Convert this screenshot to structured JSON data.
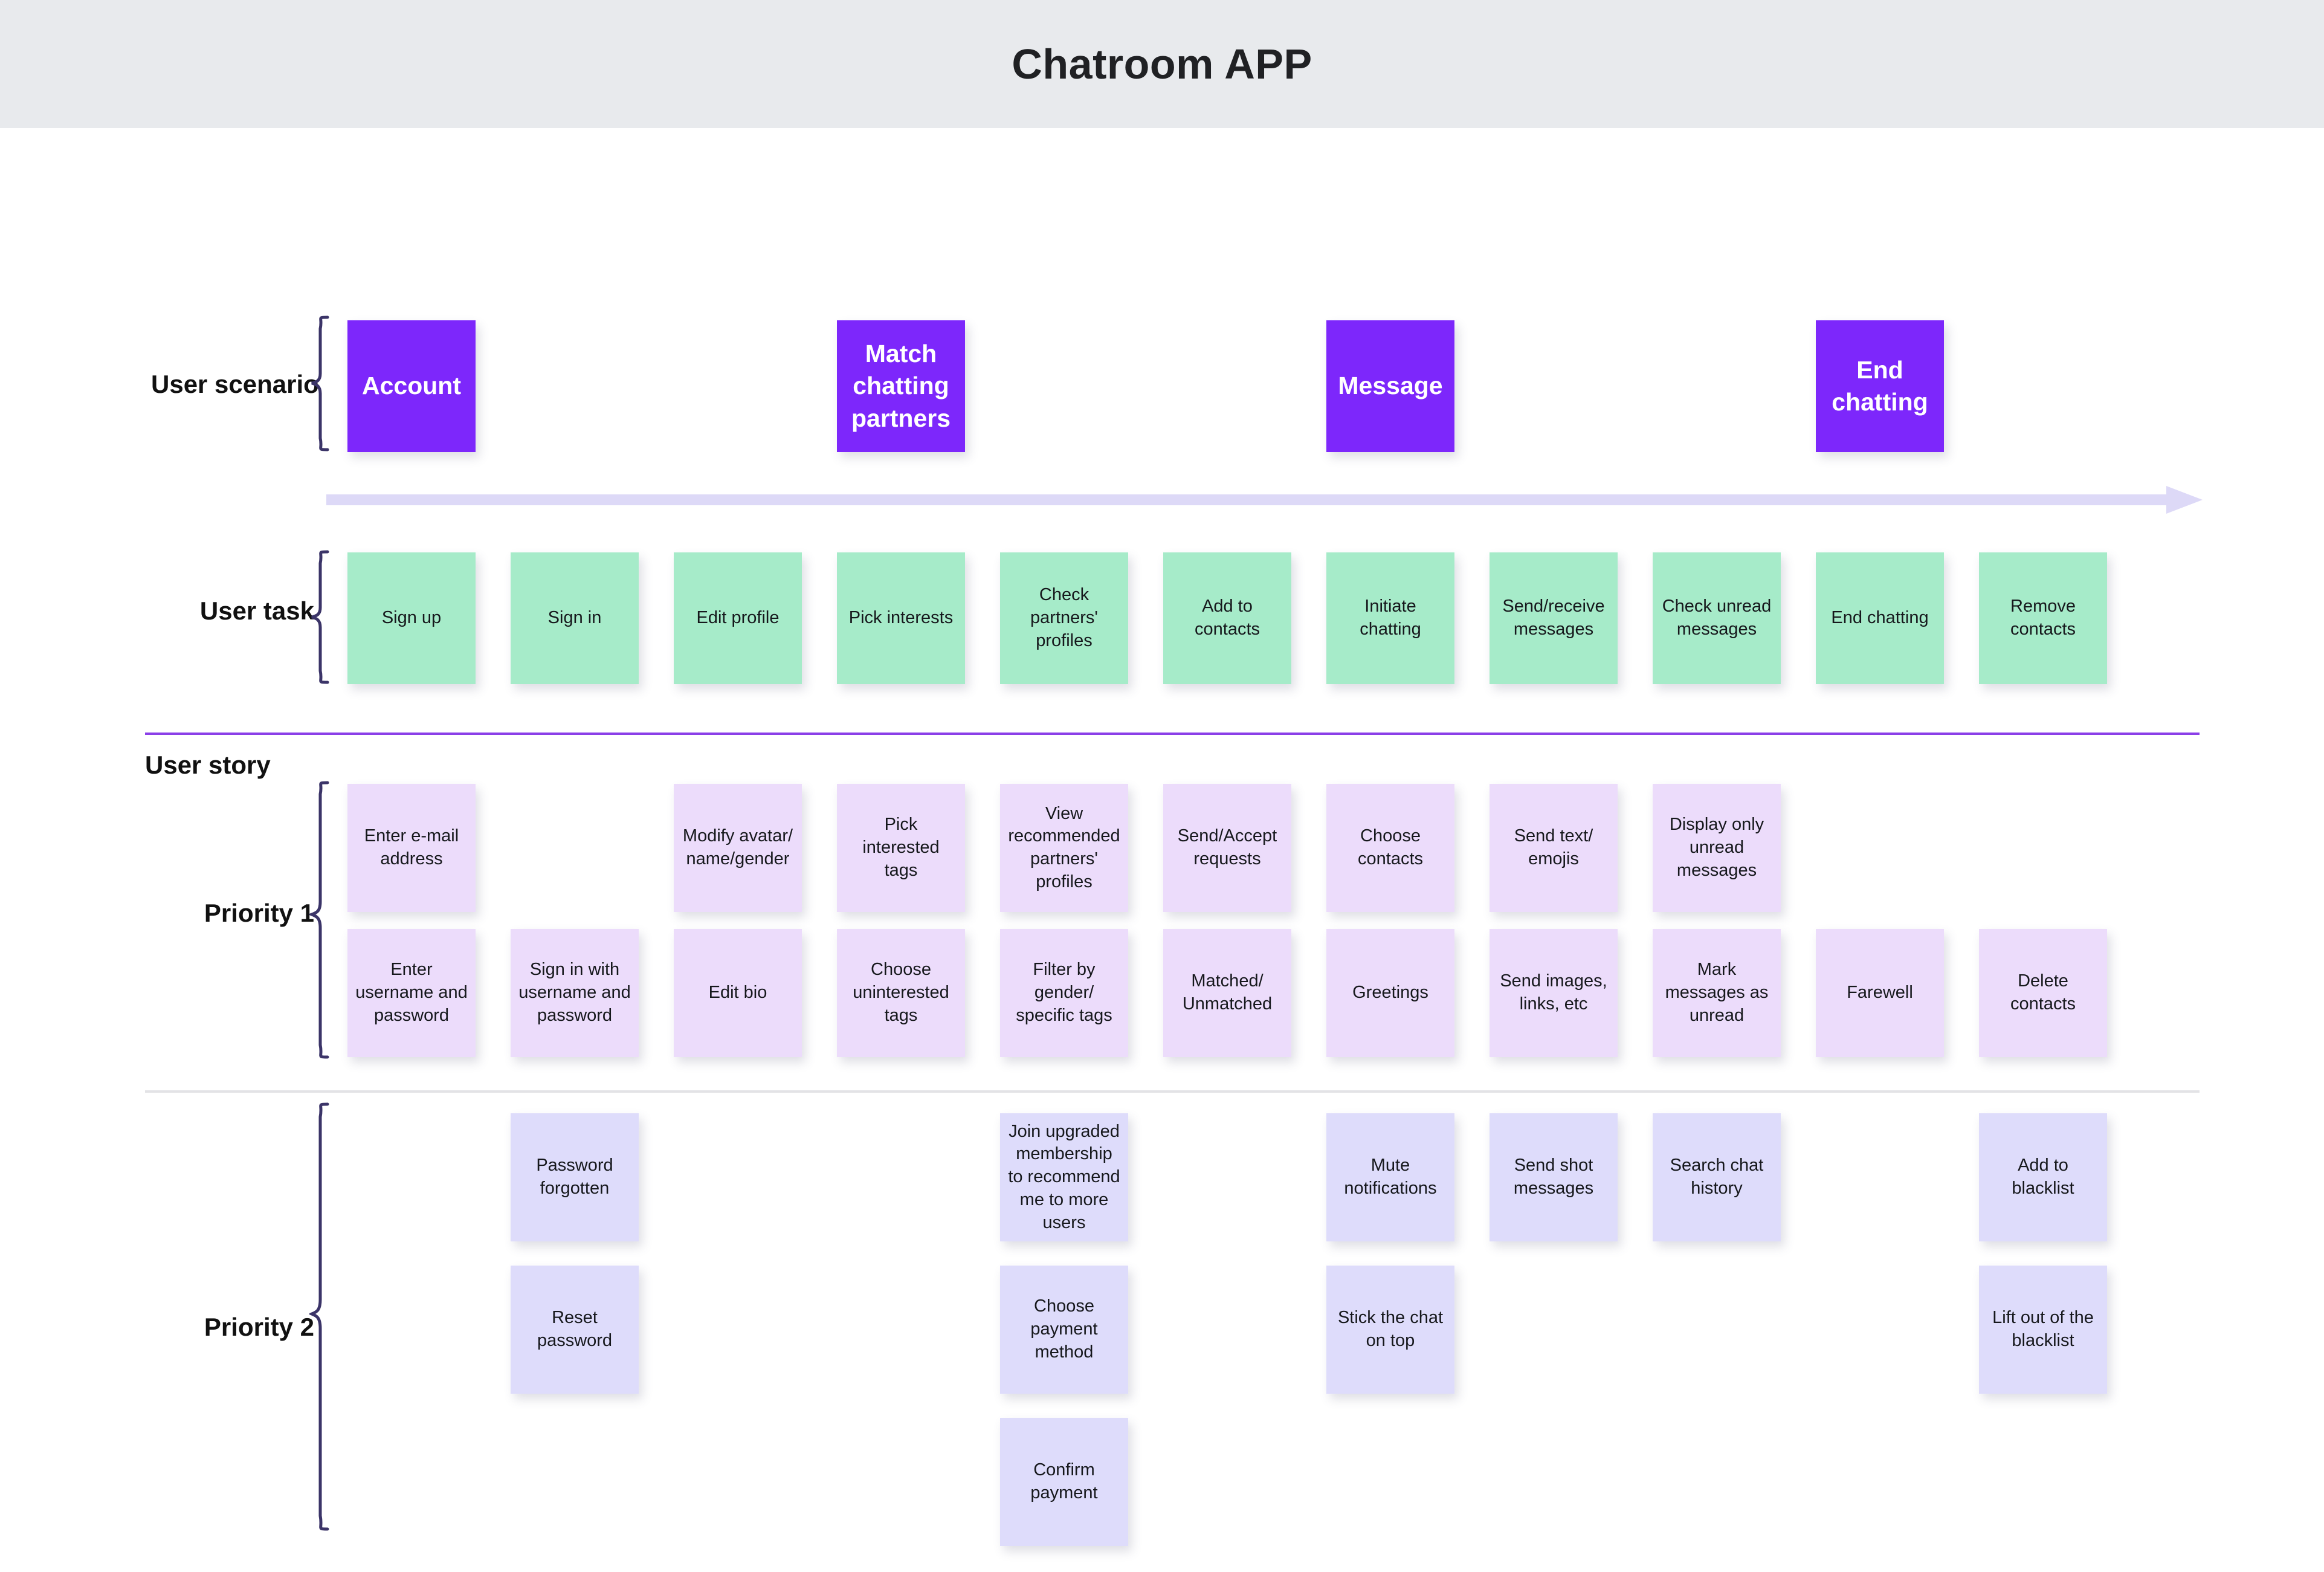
{
  "header": {
    "title": "Chatroom APP"
  },
  "colors": {
    "header_bg": "#e8eaed",
    "scenario_card": "#7d27fb",
    "task_card": "#a6ebc9",
    "priority1_card": "#ecdcfb",
    "priority2_card": "#dedcfb",
    "brace": "#3b3468",
    "arrow": "#ddd9f7",
    "divider_purple": "#8b3fe8",
    "divider_grey": "#e3e3e6"
  },
  "rows": {
    "user_scenario_label": "User scenario",
    "user_task_label": "User task",
    "user_story_label": "User story",
    "priority1_label": "Priority 1",
    "priority2_label": "Priority 2"
  },
  "user_scenario": [
    {
      "label": "Account",
      "column": 0
    },
    {
      "label": "Match\nchatting\npartners",
      "column": 3
    },
    {
      "label": "Message",
      "column": 6
    },
    {
      "label": "End\nchatting",
      "column": 9
    }
  ],
  "user_task": [
    {
      "label": "Sign up",
      "column": 0
    },
    {
      "label": "Sign in",
      "column": 1
    },
    {
      "label": "Edit profile",
      "column": 2
    },
    {
      "label": "Pick interests",
      "column": 3
    },
    {
      "label": "Check\npartners'\nprofiles",
      "column": 4
    },
    {
      "label": "Add to\ncontacts",
      "column": 5
    },
    {
      "label": "Initiate\nchatting",
      "column": 6
    },
    {
      "label": "Send/receive\nmessages",
      "column": 7
    },
    {
      "label": "Check unread\nmessages",
      "column": 8
    },
    {
      "label": "End chatting",
      "column": 9
    },
    {
      "label": "Remove\ncontacts",
      "column": 10
    }
  ],
  "priority1": [
    [
      {
        "label": "Enter e-mail\naddress",
        "column": 0
      },
      {
        "label": "Modify avatar/\nname/gender",
        "column": 2
      },
      {
        "label": "Pick\ninterested\ntags",
        "column": 3
      },
      {
        "label": "View\nrecommended\npartners'\nprofiles",
        "column": 4
      },
      {
        "label": "Send/Accept\nrequests",
        "column": 5
      },
      {
        "label": "Choose\ncontacts",
        "column": 6
      },
      {
        "label": "Send text/\nemojis",
        "column": 7
      },
      {
        "label": "Display only\nunread\nmessages",
        "column": 8
      }
    ],
    [
      {
        "label": "Enter\nusername and\npassword",
        "column": 0
      },
      {
        "label": "Sign in with\nusername and\npassword",
        "column": 1
      },
      {
        "label": "Edit bio",
        "column": 2
      },
      {
        "label": "Choose\nuninterested\ntags",
        "column": 3
      },
      {
        "label": "Filter by\ngender/\nspecific tags",
        "column": 4
      },
      {
        "label": "Matched/\nUnmatched",
        "column": 5
      },
      {
        "label": "Greetings",
        "column": 6
      },
      {
        "label": "Send images,\nlinks, etc",
        "column": 7
      },
      {
        "label": "Mark\nmessages as\nunread",
        "column": 8
      },
      {
        "label": "Farewell",
        "column": 9
      },
      {
        "label": "Delete\ncontacts",
        "column": 10
      }
    ]
  ],
  "priority2": [
    [
      {
        "label": "Password\nforgotten",
        "column": 1
      },
      {
        "label": "Join upgraded\nmembership\nto recommend\nme to more\nusers",
        "column": 4
      },
      {
        "label": "Mute\nnotifications",
        "column": 6
      },
      {
        "label": "Send shot\nmessages",
        "column": 7
      },
      {
        "label": "Search chat\nhistory",
        "column": 8
      },
      {
        "label": "Add to\nblacklist",
        "column": 10
      }
    ],
    [
      {
        "label": "Reset\npassword",
        "column": 1
      },
      {
        "label": "Choose\npayment\nmethod",
        "column": 4
      },
      {
        "label": "Stick the chat\non top",
        "column": 6
      },
      {
        "label": "Lift out of the\nblacklist",
        "column": 10
      }
    ],
    [
      {
        "label": "Confirm\npayment",
        "column": 4
      }
    ]
  ]
}
